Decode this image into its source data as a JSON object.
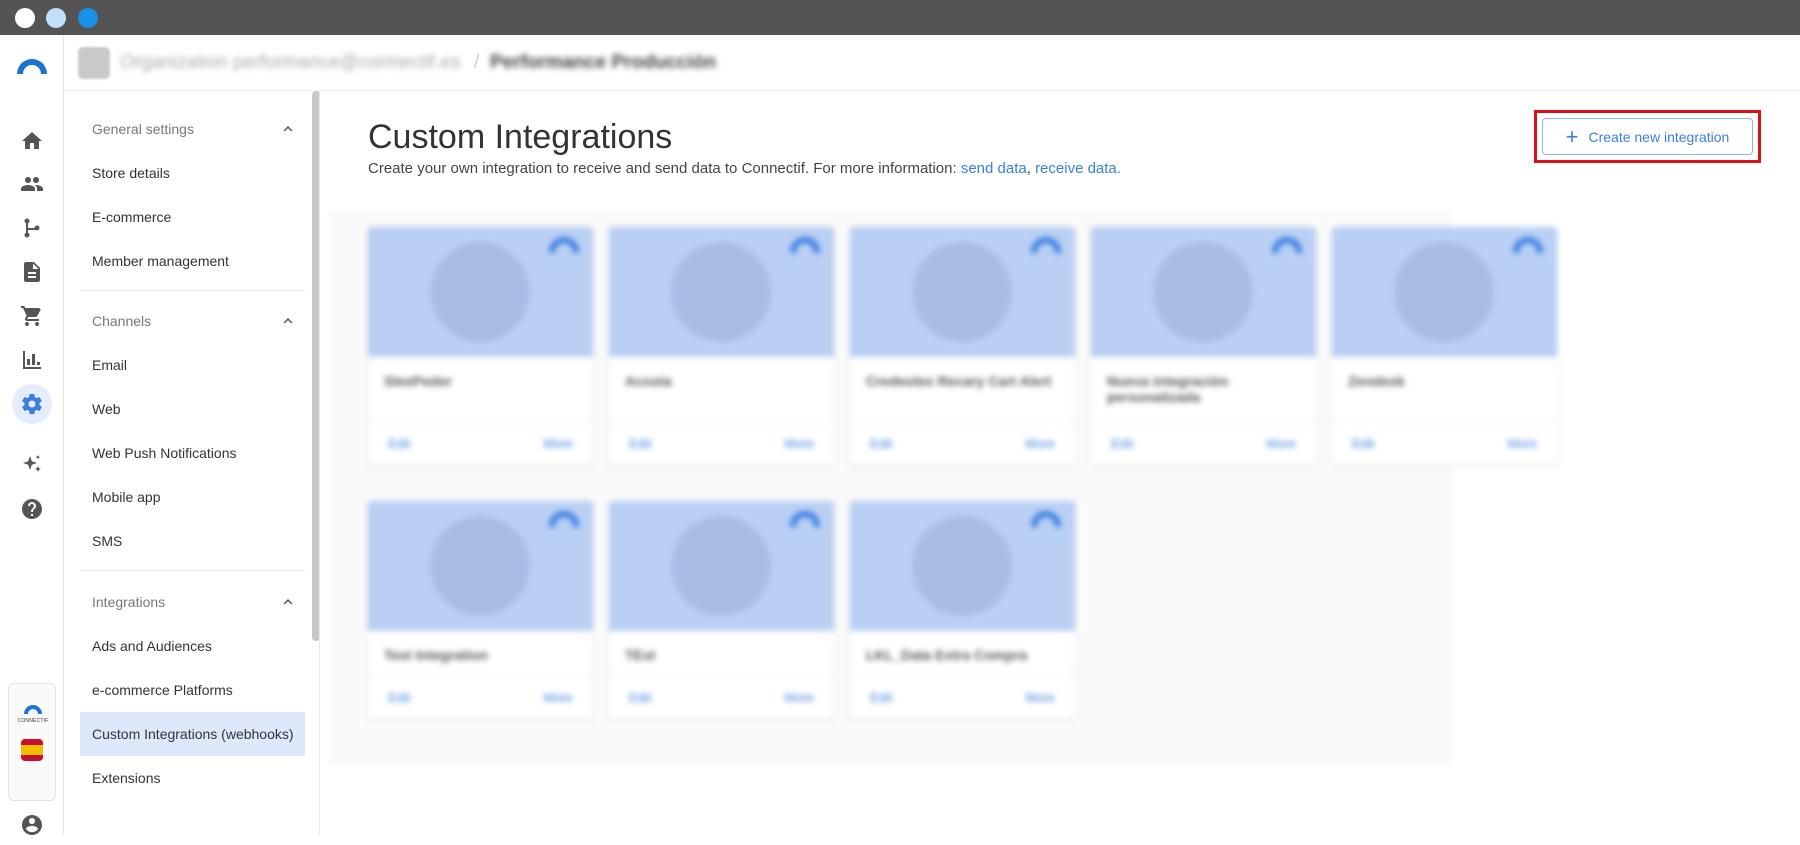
{
  "window": {
    "controls": [
      "close",
      "minimize",
      "maximize"
    ]
  },
  "rail": {
    "items": [
      {
        "icon": "home-icon"
      },
      {
        "icon": "contacts-icon"
      },
      {
        "icon": "workflows-icon"
      },
      {
        "icon": "content-icon"
      },
      {
        "icon": "cart-icon"
      },
      {
        "icon": "reports-icon"
      },
      {
        "icon": "settings-icon",
        "active": true
      },
      {
        "icon": "sparkles-icon"
      },
      {
        "icon": "help-icon"
      }
    ],
    "brand_label": "CONNECTIF"
  },
  "header": {
    "organization": "Organization performance@connectif.es",
    "separator": "/",
    "account": "Performance Producción"
  },
  "sidebar": {
    "sections": [
      {
        "title": "General settings",
        "items": [
          "Store details",
          "E-commerce",
          "Member management"
        ]
      },
      {
        "title": "Channels",
        "items": [
          "Email",
          "Web",
          "Web Push Notifications",
          "Mobile app",
          "SMS"
        ]
      },
      {
        "title": "Integrations",
        "items": [
          "Ads and Audiences",
          "e-commerce Platforms",
          "Custom Integrations (webhooks)",
          "Extensions"
        ]
      }
    ],
    "selected": "Custom Integrations (webhooks)"
  },
  "main": {
    "title": "Custom Integrations",
    "subtitle_prefix": "Create your own integration to receive and send data to Connectif. For more information: ",
    "link_send": "send data",
    "comma": ",",
    "link_receive": "receive data.",
    "create_button": "Create new integration",
    "cards": [
      {
        "title": "SleePeder",
        "edit": "Edit",
        "more": "More"
      },
      {
        "title": "Acosta",
        "edit": "Edit",
        "more": "More"
      },
      {
        "title": "Credeoles Recary Cart Alert",
        "edit": "Edit",
        "more": "More"
      },
      {
        "title": "Nueva integración personalizada",
        "edit": "Edit",
        "more": "More"
      },
      {
        "title": "Zendesk",
        "edit": "Edit",
        "more": "More"
      },
      {
        "title": "Test Integration",
        "edit": "Edit",
        "more": "More"
      },
      {
        "title": "TEst",
        "edit": "Edit",
        "more": "More"
      },
      {
        "title": "LKL_Data Extra Compra",
        "edit": "Edit",
        "more": "More"
      }
    ]
  },
  "colors": {
    "accent": "#3a7fe0",
    "highlight": "#d6131b",
    "selected_bg": "#dde9fb",
    "card_image": "#b9cff4"
  }
}
